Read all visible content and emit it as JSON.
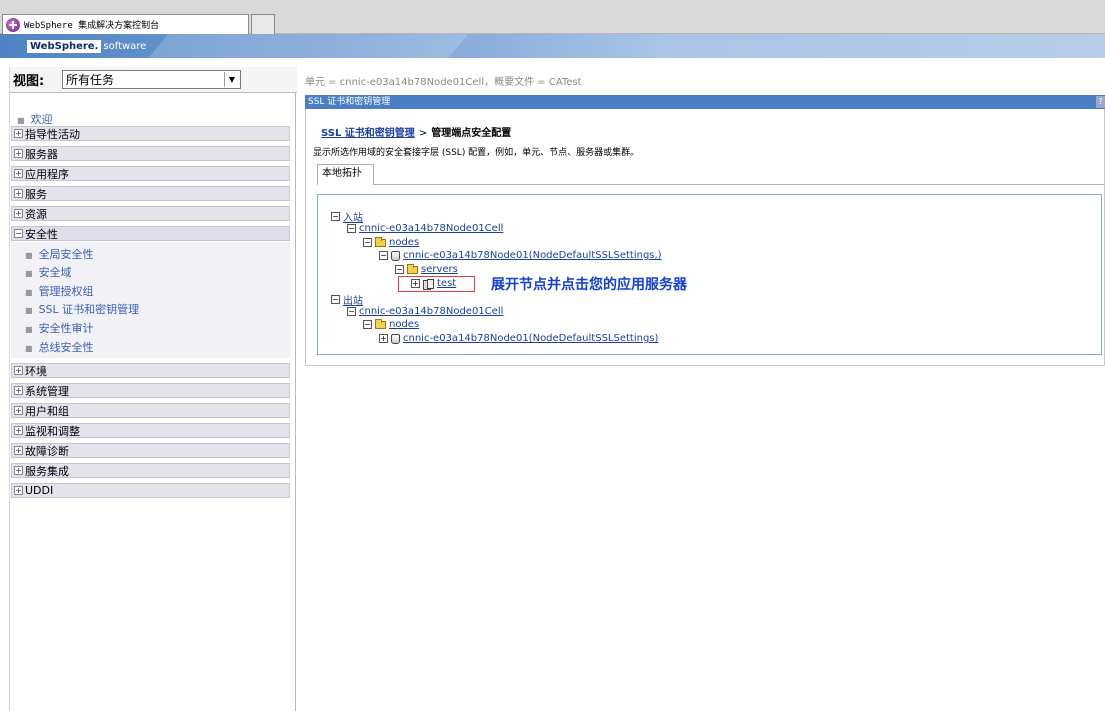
{
  "browser": {
    "tab_title": "WebSphere 集成解决方案控制台"
  },
  "banner": {
    "brand": "WebSphere.",
    "suffix": "software"
  },
  "nav": {
    "view_label": "视图:",
    "view_value": "所有任务",
    "welcome": "欢迎",
    "categories": [
      "指导性活动",
      "服务器",
      "应用程序",
      "服务",
      "资源",
      "安全性",
      "环境",
      "系统管理",
      "用户和组",
      "监视和调整",
      "故障诊断",
      "服务集成",
      "UDDI"
    ],
    "security_items": [
      "全局安全性",
      "安全域",
      "管理授权组",
      "SSL 证书和密钥管理",
      "安全性审计",
      "总线安全性"
    ]
  },
  "main": {
    "scope": "单元 = cnnic-e03a14b78Node01Cell，概要文件 = CATest",
    "panel_title": "SSL 证书和密钥管理",
    "help": "?",
    "breadcrumb_link": "SSL 证书和密钥管理",
    "breadcrumb_sep": ">",
    "breadcrumb_current": "管理端点安全配置",
    "description": "显示所选作用域的安全套接字层 (SSL) 配置，例如，单元、节点、服务器或集群。",
    "subtab": "本地拓扑",
    "tree": {
      "inbound": "入站",
      "inbound_cell": "cnnic-e03a14b78Node01Cell",
      "inbound_nodes": "nodes",
      "inbound_node": "cnnic-e03a14b78Node01(NodeDefaultSSLSettings,)",
      "servers": "servers",
      "server": "test",
      "outbound": "出站",
      "outbound_cell": "cnnic-e03a14b78Node01Cell",
      "outbound_nodes": "nodes",
      "outbound_node": "cnnic-e03a14b78Node01(NodeDefaultSSLSettings)"
    },
    "annotation": "展开节点并点击您的应用服务器"
  }
}
